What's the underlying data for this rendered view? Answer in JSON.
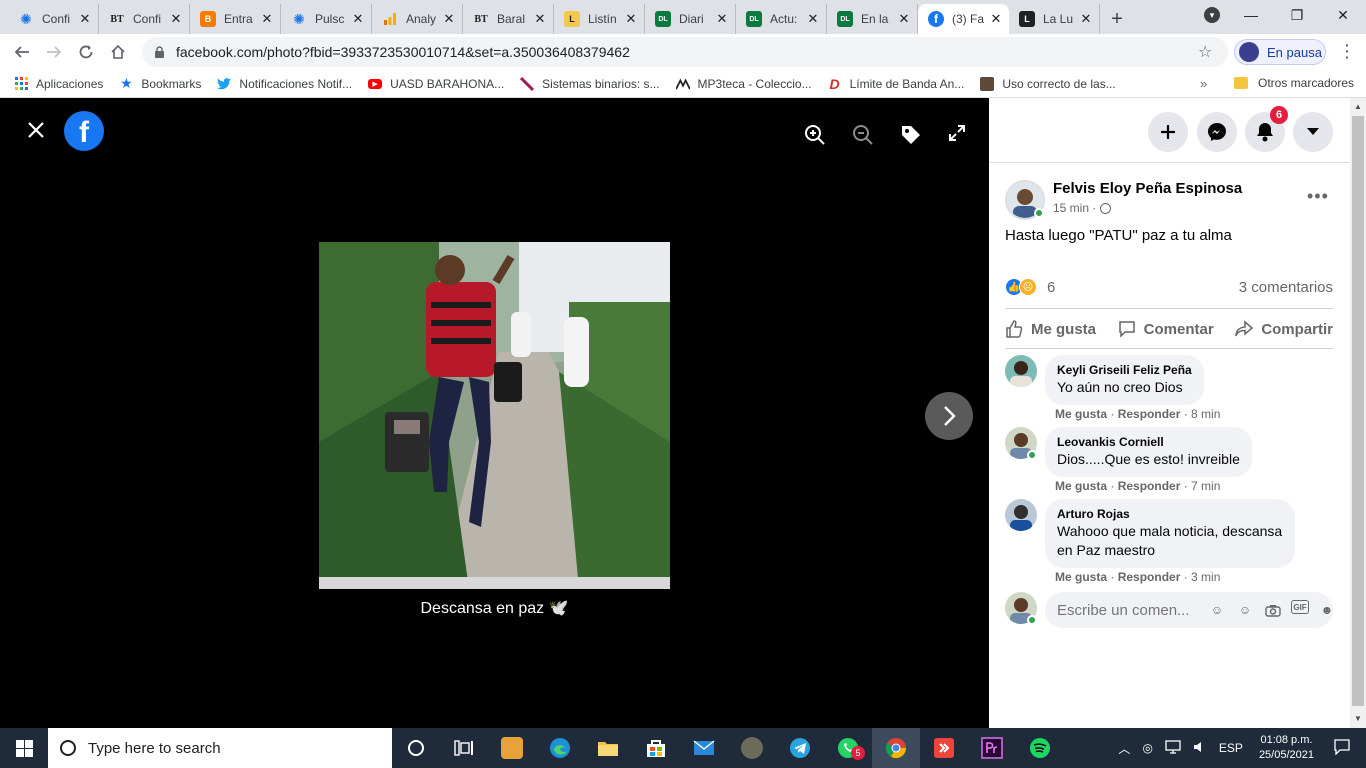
{
  "tabs": [
    {
      "title": "Confi",
      "icon": "wave-icon",
      "color": "#1a73e8"
    },
    {
      "title": "Confi",
      "icon": "bt-icon",
      "color": "#202124"
    },
    {
      "title": "Entra",
      "icon": "blogger-icon",
      "color": "#f57c00"
    },
    {
      "title": "Pulsc",
      "icon": "wave-icon",
      "color": "#1a73e8"
    },
    {
      "title": "Analy",
      "icon": "analytics-icon",
      "color": "#f9ab00"
    },
    {
      "title": "Baral",
      "icon": "bt-icon",
      "color": "#202124"
    },
    {
      "title": "Listín",
      "icon": "listin-icon",
      "color": "#f2c94c"
    },
    {
      "title": "Diari",
      "icon": "diario-libre-icon",
      "color": "#0b7a3e"
    },
    {
      "title": "Actu:",
      "icon": "diario-libre-icon",
      "color": "#0b7a3e"
    },
    {
      "title": "En la",
      "icon": "diario-libre-icon",
      "color": "#0b7a3e"
    },
    {
      "title": "(3) Fa",
      "icon": "facebook-icon",
      "color": "#1877f2",
      "active": true
    },
    {
      "title": "La Lu",
      "icon": "lalu-icon",
      "color": "#202124"
    }
  ],
  "tab_icon_letters": {
    "bt": "BT",
    "blogger": "B",
    "listin": "L",
    "diario": "DL",
    "fb": "f",
    "lalu": "L"
  },
  "window": {
    "minimize": "—",
    "maximize": "❐",
    "close": "✕"
  },
  "url": "facebook.com/photo?fbid=3933723530010714&set=a.350036408379462",
  "profile": {
    "label": "En pausa"
  },
  "bookmarks": [
    {
      "label": "Aplicaciones",
      "icon": "apps-grid-icon"
    },
    {
      "label": "Bookmarks",
      "icon": "star-icon"
    },
    {
      "label": "Notificaciones Notif...",
      "icon": "twitter-icon"
    },
    {
      "label": "UASD BARAHONA...",
      "icon": "youtube-icon"
    },
    {
      "label": "Sistemas binarios: s...",
      "icon": "feather-icon"
    },
    {
      "label": "MP3teca - Coleccio...",
      "icon": "mp3teca-icon"
    },
    {
      "label": "Límite de Banda An...",
      "icon": "d-icon"
    },
    {
      "label": "Uso correcto de las...",
      "icon": "image-icon"
    }
  ],
  "bookmarks_more": "»",
  "other_bookmarks": "Otros marcadores",
  "viewer": {
    "caption": "Descansa en paz 🕊️"
  },
  "side": {
    "notif_count": "6",
    "author": "Felvis Eloy Peña Espinosa",
    "time": "15 min ·",
    "post_text": "Hasta luego \"PATU\" paz a tu alma",
    "reaction_count": "6",
    "comments_count": "3 comentarios",
    "actions": {
      "like": "Me gusta",
      "comment": "Comentar",
      "share": "Compartir"
    },
    "comments": [
      {
        "name": "Keyli Griseili Feliz Peña",
        "text": "Yo aún no creo Dios",
        "like": "Me gusta",
        "reply": "Responder",
        "time": "· 8 min"
      },
      {
        "name": "Leovankis Corniell",
        "text": "Dios.....Que es esto! invreible",
        "like": "Me gusta",
        "reply": "Responder",
        "time": "· 7 min"
      },
      {
        "name": "Arturo Rojas",
        "text": "Wahooo que mala noticia, descansa en Paz maestro",
        "like": "Me gusta",
        "reply": "Responder",
        "time": "· 3 min"
      }
    ],
    "composer_placeholder": "Escribe un comen...",
    "gif_label": "GIF"
  },
  "taskbar": {
    "search_placeholder": "Type here to search",
    "whatsapp_badge": "5",
    "lang": "ESP",
    "time": "01:08 p.m.",
    "date": "25/05/2021"
  }
}
